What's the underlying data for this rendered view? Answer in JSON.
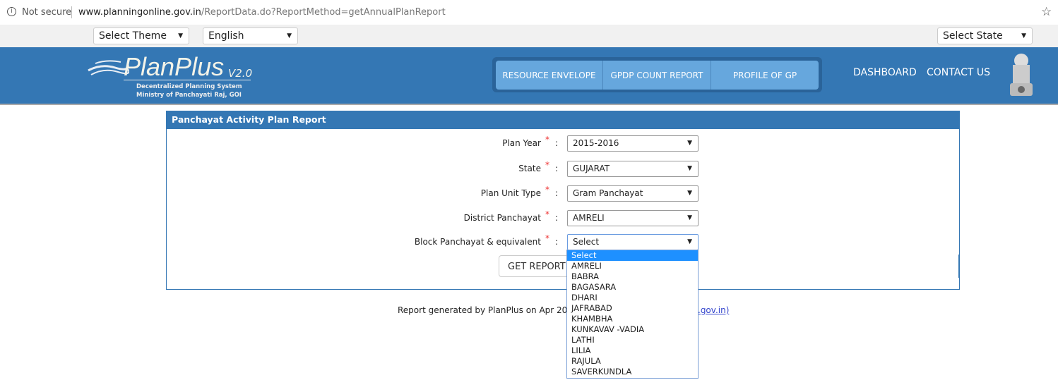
{
  "browser": {
    "security": "Not secure",
    "url_host": "www.planningonline.gov.in",
    "url_path": "/ReportData.do?ReportMethod=getAnnualPlanReport"
  },
  "toolbar": {
    "theme": "Select Theme",
    "language": "English",
    "state": "Select State"
  },
  "header": {
    "logo": "PlanPlus",
    "version": "V2.0",
    "sub1": "Decentralized Planning System",
    "sub2": "Ministry of Panchayati Raj, GOI",
    "nav": [
      "RESOURCE ENVELOPE",
      "GPDP COUNT REPORT",
      "PROFILE OF GP"
    ],
    "dashboard": "DASHBOARD",
    "contact": "CONTACT US"
  },
  "colors": {
    "brand": "#3477b4",
    "highlight": "#1e90ff"
  },
  "panel": {
    "title": "Panchayat Activity Plan Report",
    "fields": [
      {
        "label": "Plan Year",
        "value": "2015-2016"
      },
      {
        "label": "State",
        "value": "GUJARAT"
      },
      {
        "label": "Plan Unit Type",
        "value": "Gram Panchayat"
      },
      {
        "label": "District Panchayat",
        "value": "AMRELI"
      },
      {
        "label": "Block Panchayat & equivalent",
        "value": "Select"
      }
    ],
    "required": "*",
    "colon": ":",
    "button": "GET REPORT",
    "dropdown": [
      "Select",
      "AMRELI",
      "BABRA",
      "BAGASARA",
      "DHARI",
      "JAFRABAD",
      "KHAMBHA",
      "KUNKAVAV -VADIA",
      "LATHI",
      "LILIA",
      "RAJULA",
      "SAVERKUNDLA"
    ]
  },
  "footer": {
    "text": "Report generated by PlanPlus on Apr 20, 2",
    "link": ".gov.in)"
  }
}
